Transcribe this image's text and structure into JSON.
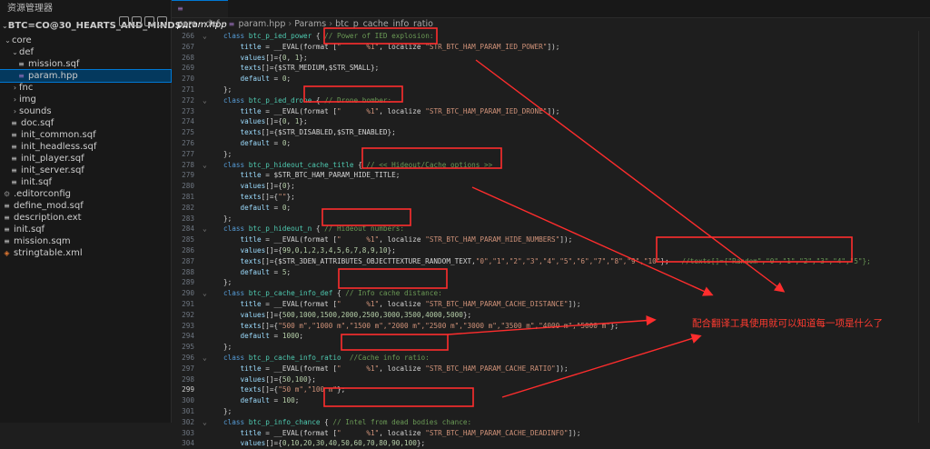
{
  "sidebar": {
    "title": "资源管理器",
    "root_label": "BTC=CO@30_HEARTS_AND_MINDS...",
    "items": [
      {
        "label": "core",
        "type": "folder",
        "open": true,
        "depth": 0
      },
      {
        "label": "def",
        "type": "folder",
        "open": true,
        "depth": 1
      },
      {
        "label": "mission.sqf",
        "type": "sqf",
        "depth": 2
      },
      {
        "label": "param.hpp",
        "type": "hpp",
        "depth": 2,
        "selected": true
      },
      {
        "label": "fnc",
        "type": "folder",
        "open": false,
        "depth": 1
      },
      {
        "label": "img",
        "type": "folder",
        "open": false,
        "depth": 1
      },
      {
        "label": "sounds",
        "type": "folder",
        "open": false,
        "depth": 1
      },
      {
        "label": "doc.sqf",
        "type": "sqf",
        "depth": 1
      },
      {
        "label": "init_common.sqf",
        "type": "sqf",
        "depth": 1
      },
      {
        "label": "init_headless.sqf",
        "type": "sqf",
        "depth": 1
      },
      {
        "label": "init_player.sqf",
        "type": "sqf",
        "depth": 1
      },
      {
        "label": "init_server.sqf",
        "type": "sqf",
        "depth": 1
      },
      {
        "label": "init.sqf",
        "type": "sqf",
        "depth": 1
      },
      {
        "label": ".editorconfig",
        "type": "gear",
        "depth": 0
      },
      {
        "label": "define_mod.sqf",
        "type": "sqf",
        "depth": 0
      },
      {
        "label": "description.ext",
        "type": "sqf",
        "depth": 0
      },
      {
        "label": "init.sqf",
        "type": "sqf",
        "depth": 0
      },
      {
        "label": "mission.sqm",
        "type": "sqf",
        "depth": 0
      },
      {
        "label": "stringtable.xml",
        "type": "xml",
        "depth": 0
      }
    ]
  },
  "editor": {
    "tab_label": "param.hpp",
    "breadcrumb": [
      "core",
      "def",
      "param.hpp",
      "Params",
      "btc_p_cache_info_ratio"
    ],
    "current_line": 299,
    "lines": [
      {
        "n": 266,
        "segs": [
          [
            "k",
            "class "
          ],
          [
            "cls",
            "btc_p_ied_power"
          ],
          [
            "g",
            " { "
          ],
          [
            "c",
            "// Power of IED explosion:"
          ]
        ]
      },
      {
        "n": 267,
        "segs": [
          [
            "g",
            "    "
          ],
          [
            "v",
            "title"
          ],
          [
            "g",
            " = __EVAL(format ["
          ],
          [
            "s",
            "\"      %1\""
          ],
          [
            "g",
            ", localize "
          ],
          [
            "s",
            "\"STR_BTC_HAM_PARAM_IED_POWER\""
          ],
          [
            "g",
            "]);"
          ]
        ]
      },
      {
        "n": 268,
        "segs": [
          [
            "g",
            "    "
          ],
          [
            "v",
            "values"
          ],
          [
            "g",
            "[]={"
          ],
          [
            "n",
            "0"
          ],
          [
            "g",
            ", "
          ],
          [
            "n",
            "1"
          ],
          [
            "g",
            "};"
          ]
        ]
      },
      {
        "n": 269,
        "segs": [
          [
            "g",
            "    "
          ],
          [
            "v",
            "texts"
          ],
          [
            "g",
            "[]={$STR_MEDIUM,$STR_SMALL};"
          ]
        ]
      },
      {
        "n": 270,
        "segs": [
          [
            "g",
            "    "
          ],
          [
            "v",
            "default"
          ],
          [
            "g",
            " = "
          ],
          [
            "n",
            "0"
          ],
          [
            "g",
            ";"
          ]
        ]
      },
      {
        "n": 271,
        "segs": [
          [
            "g",
            "};"
          ]
        ]
      },
      {
        "n": 272,
        "segs": [
          [
            "k",
            "class "
          ],
          [
            "cls",
            "btc_p_ied_drone"
          ],
          [
            "g",
            " { "
          ],
          [
            "c",
            "// Drone bomber:"
          ]
        ]
      },
      {
        "n": 273,
        "segs": [
          [
            "g",
            "    "
          ],
          [
            "v",
            "title"
          ],
          [
            "g",
            " = __EVAL(format ["
          ],
          [
            "s",
            "\"      %1\""
          ],
          [
            "g",
            ", localize "
          ],
          [
            "s",
            "\"STR_BTC_HAM_PARAM_IED_DRONE\""
          ],
          [
            "g",
            "]);"
          ]
        ]
      },
      {
        "n": 274,
        "segs": [
          [
            "g",
            "    "
          ],
          [
            "v",
            "values"
          ],
          [
            "g",
            "[]={"
          ],
          [
            "n",
            "0"
          ],
          [
            "g",
            ", "
          ],
          [
            "n",
            "1"
          ],
          [
            "g",
            "};"
          ]
        ]
      },
      {
        "n": 275,
        "segs": [
          [
            "g",
            "    "
          ],
          [
            "v",
            "texts"
          ],
          [
            "g",
            "[]={$STR_DISABLED,$STR_ENABLED};"
          ]
        ]
      },
      {
        "n": 276,
        "segs": [
          [
            "g",
            "    "
          ],
          [
            "v",
            "default"
          ],
          [
            "g",
            " = "
          ],
          [
            "n",
            "0"
          ],
          [
            "g",
            ";"
          ]
        ]
      },
      {
        "n": 277,
        "segs": [
          [
            "g",
            "};"
          ]
        ]
      },
      {
        "n": 278,
        "segs": [
          [
            "k",
            "class "
          ],
          [
            "cls",
            "btc_p_hideout_cache_title"
          ],
          [
            "g",
            " { "
          ],
          [
            "c",
            "// << Hideout/Cache options >>"
          ]
        ]
      },
      {
        "n": 279,
        "segs": [
          [
            "g",
            "    "
          ],
          [
            "v",
            "title"
          ],
          [
            "g",
            " = $STR_BTC_HAM_PARAM_HIDE_TITLE;"
          ]
        ]
      },
      {
        "n": 280,
        "segs": [
          [
            "g",
            "    "
          ],
          [
            "v",
            "values"
          ],
          [
            "g",
            "[]={"
          ],
          [
            "n",
            "0"
          ],
          [
            "g",
            "};"
          ]
        ]
      },
      {
        "n": 281,
        "segs": [
          [
            "g",
            "    "
          ],
          [
            "v",
            "texts"
          ],
          [
            "g",
            "[]={"
          ],
          [
            "s",
            "\"\""
          ],
          [
            "g",
            "};"
          ]
        ]
      },
      {
        "n": 282,
        "segs": [
          [
            "g",
            "    "
          ],
          [
            "v",
            "default"
          ],
          [
            "g",
            " = "
          ],
          [
            "n",
            "0"
          ],
          [
            "g",
            ";"
          ]
        ]
      },
      {
        "n": 283,
        "segs": [
          [
            "g",
            "};"
          ]
        ]
      },
      {
        "n": 284,
        "segs": [
          [
            "k",
            "class "
          ],
          [
            "cls",
            "btc_p_hideout_n"
          ],
          [
            "g",
            " { "
          ],
          [
            "c",
            "// Hideout numbers:"
          ]
        ]
      },
      {
        "n": 285,
        "segs": [
          [
            "g",
            "    "
          ],
          [
            "v",
            "title"
          ],
          [
            "g",
            " = __EVAL(format ["
          ],
          [
            "s",
            "\"      %1\""
          ],
          [
            "g",
            ", localize "
          ],
          [
            "s",
            "\"STR_BTC_HAM_PARAM_HIDE_NUMBERS\""
          ],
          [
            "g",
            "]);"
          ]
        ]
      },
      {
        "n": 286,
        "segs": [
          [
            "g",
            "    "
          ],
          [
            "v",
            "values"
          ],
          [
            "g",
            "[]={"
          ],
          [
            "n",
            "99,0,1,2,3,4,5,6,7,8,9,10"
          ],
          [
            "g",
            "};"
          ]
        ]
      },
      {
        "n": 287,
        "segs": [
          [
            "g",
            "    "
          ],
          [
            "v",
            "texts"
          ],
          [
            "g",
            "[]={$STR_3DEN_ATTRIBUTES_OBJECTTEXTURE_RANDOM_TEXT,"
          ],
          [
            "s",
            "\"0\",\"1\",\"2\",\"3\",\"4\",\"5\",\"6\",\"7\",\"8\",\"9\",\"10\""
          ],
          [
            "g",
            "};   "
          ],
          [
            "c",
            "//texts[]={\"Random\",\"0\",\"1\",\"2\",\"3\",\"4\",\"5\"};"
          ]
        ]
      },
      {
        "n": 288,
        "segs": [
          [
            "g",
            "    "
          ],
          [
            "v",
            "default"
          ],
          [
            "g",
            " = "
          ],
          [
            "n",
            "5"
          ],
          [
            "g",
            ";"
          ]
        ]
      },
      {
        "n": 289,
        "segs": [
          [
            "g",
            "};"
          ]
        ]
      },
      {
        "n": 290,
        "segs": [
          [
            "k",
            "class "
          ],
          [
            "cls",
            "btc_p_cache_info_def"
          ],
          [
            "g",
            " { "
          ],
          [
            "c",
            "// Info cache distance:"
          ]
        ]
      },
      {
        "n": 291,
        "segs": [
          [
            "g",
            "    "
          ],
          [
            "v",
            "title"
          ],
          [
            "g",
            " = __EVAL(format ["
          ],
          [
            "s",
            "\"      %1\""
          ],
          [
            "g",
            ", localize "
          ],
          [
            "s",
            "\"STR_BTC_HAM_PARAM_CACHE_DISTANCE\""
          ],
          [
            "g",
            "]);"
          ]
        ]
      },
      {
        "n": 292,
        "segs": [
          [
            "g",
            "    "
          ],
          [
            "v",
            "values"
          ],
          [
            "g",
            "[]={"
          ],
          [
            "n",
            "500,1000,1500,2000,2500,3000,3500,4000,5000"
          ],
          [
            "g",
            "};"
          ]
        ]
      },
      {
        "n": 293,
        "segs": [
          [
            "g",
            "    "
          ],
          [
            "v",
            "texts"
          ],
          [
            "g",
            "[]={"
          ],
          [
            "s",
            "\"500 m\",\"1000 m\",\"1500 m\",\"2000 m\",\"2500 m\",\"3000 m\",\"3500 m\",\"4000 m\",\"5000 m\""
          ],
          [
            "g",
            "};"
          ]
        ]
      },
      {
        "n": 294,
        "segs": [
          [
            "g",
            "    "
          ],
          [
            "v",
            "default"
          ],
          [
            "g",
            " = "
          ],
          [
            "n",
            "1000"
          ],
          [
            "g",
            ";"
          ]
        ]
      },
      {
        "n": 295,
        "segs": [
          [
            "g",
            "};"
          ]
        ]
      },
      {
        "n": 296,
        "segs": [
          [
            "k",
            "class "
          ],
          [
            "cls",
            "btc_p_cache_info_ratio"
          ],
          [
            "g",
            "  "
          ],
          [
            "c",
            "//Cache info ratio:"
          ]
        ]
      },
      {
        "n": 297,
        "segs": [
          [
            "g",
            "    "
          ],
          [
            "v",
            "title"
          ],
          [
            "g",
            " = __EVAL(format ["
          ],
          [
            "s",
            "\"      %1\""
          ],
          [
            "g",
            ", localize "
          ],
          [
            "s",
            "\"STR_BTC_HAM_PARAM_CACHE_RATIO\""
          ],
          [
            "g",
            "]);"
          ]
        ]
      },
      {
        "n": 298,
        "segs": [
          [
            "g",
            "    "
          ],
          [
            "v",
            "values"
          ],
          [
            "g",
            "[]={"
          ],
          [
            "n",
            "50,100"
          ],
          [
            "g",
            "};"
          ]
        ]
      },
      {
        "n": 299,
        "segs": [
          [
            "g",
            "    "
          ],
          [
            "v",
            "texts"
          ],
          [
            "g",
            "[]={"
          ],
          [
            "s",
            "\"50 m\",\"100 m\""
          ],
          [
            "g",
            "};"
          ]
        ]
      },
      {
        "n": 300,
        "segs": [
          [
            "g",
            "    "
          ],
          [
            "v",
            "default"
          ],
          [
            "g",
            " = "
          ],
          [
            "n",
            "100"
          ],
          [
            "g",
            ";"
          ]
        ]
      },
      {
        "n": 301,
        "segs": [
          [
            "g",
            "};"
          ]
        ]
      },
      {
        "n": 302,
        "segs": [
          [
            "k",
            "class "
          ],
          [
            "cls",
            "btc_p_info_chance"
          ],
          [
            "g",
            " { "
          ],
          [
            "c",
            "// Intel from dead bodies chance:"
          ]
        ]
      },
      {
        "n": 303,
        "segs": [
          [
            "g",
            "    "
          ],
          [
            "v",
            "title"
          ],
          [
            "g",
            " = __EVAL(format ["
          ],
          [
            "s",
            "\"      %1\""
          ],
          [
            "g",
            ", localize "
          ],
          [
            "s",
            "\"STR_BTC_HAM_PARAM_CACHE_DEADINFO\""
          ],
          [
            "g",
            "]);"
          ]
        ]
      },
      {
        "n": 304,
        "segs": [
          [
            "g",
            "    "
          ],
          [
            "v",
            "values"
          ],
          [
            "g",
            "[]={"
          ],
          [
            "n",
            "0,10,20,30,40,50,60,70,80,90,100"
          ],
          [
            "g",
            "};"
          ]
        ]
      }
    ]
  },
  "annotation": {
    "note": "配合翻译工具使用就可以知道每一项是什么了",
    "color": "#ff2d2d"
  },
  "icons": {
    "chevron_open": "chevron-down-icon",
    "chevron_closed": "chevron-right-icon"
  }
}
